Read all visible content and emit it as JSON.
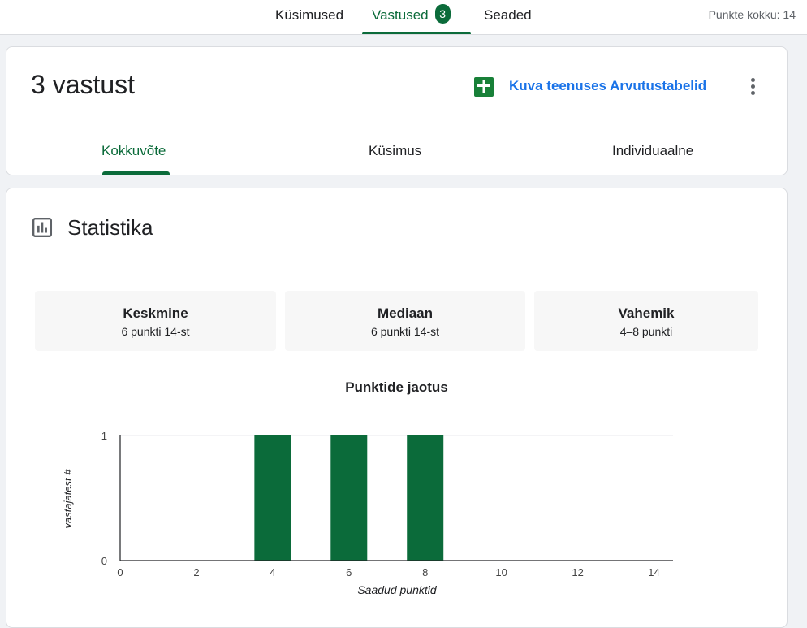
{
  "top_tabs": {
    "questions": "Küsimused",
    "responses": "Vastused",
    "responses_badge": "3",
    "settings": "Seaded"
  },
  "total_points": "Punkte kokku: 14",
  "summary_card": {
    "title": "3 vastust",
    "sheets_link": "Kuva teenuses Arvutustabelid",
    "tabs": {
      "summary": "Kokkuvõte",
      "question": "Küsimus",
      "individual": "Individuaalne"
    }
  },
  "statistics": {
    "heading": "Statistika",
    "boxes": [
      {
        "label": "Keskmine",
        "value": "6 punkti 14-st"
      },
      {
        "label": "Mediaan",
        "value": "6 punkti 14-st"
      },
      {
        "label": "Vahemik",
        "value": "4–8 punkti"
      }
    ]
  },
  "colors": {
    "accent": "#0b6b3a",
    "link": "#1a73e8",
    "sheets": "#188038"
  },
  "icons": [
    "sheets-icon",
    "more-vert-icon",
    "bar-chart-icon"
  ],
  "chart_data": {
    "type": "bar",
    "title": "Punktide jaotus",
    "xlabel": "Saadud punktid",
    "ylabel": "vastajatest #",
    "x": [
      4,
      6,
      8
    ],
    "values": [
      1,
      1,
      1
    ],
    "xlim": [
      0,
      14.5
    ],
    "ylim": [
      0,
      1
    ],
    "xticks": [
      0,
      2,
      4,
      6,
      8,
      10,
      12,
      14
    ],
    "yticks": [
      0,
      1
    ],
    "color": "#0b6b3a"
  }
}
